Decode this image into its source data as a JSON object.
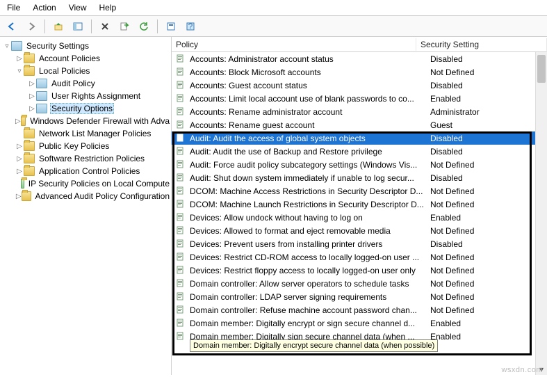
{
  "menu": {
    "file": "File",
    "action": "Action",
    "view": "View",
    "help": "Help"
  },
  "tree": {
    "root": "Security Settings",
    "items": [
      {
        "label": "Account Policies",
        "exp": "▷",
        "indent": 1,
        "sel": false
      },
      {
        "label": "Local Policies",
        "exp": "▿",
        "indent": 1,
        "sel": false
      },
      {
        "label": "Audit Policy",
        "exp": "▷",
        "indent": 2,
        "sel": false,
        "blue": true
      },
      {
        "label": "User Rights Assignment",
        "exp": "▷",
        "indent": 2,
        "sel": false,
        "blue": true
      },
      {
        "label": "Security Options",
        "exp": "▷",
        "indent": 2,
        "sel": true,
        "blue": true
      },
      {
        "label": "Windows Defender Firewall with Adva",
        "exp": "▷",
        "indent": 1,
        "sel": false
      },
      {
        "label": "Network List Manager Policies",
        "exp": "",
        "indent": 1,
        "sel": false
      },
      {
        "label": "Public Key Policies",
        "exp": "▷",
        "indent": 1,
        "sel": false
      },
      {
        "label": "Software Restriction Policies",
        "exp": "▷",
        "indent": 1,
        "sel": false
      },
      {
        "label": "Application Control Policies",
        "exp": "▷",
        "indent": 1,
        "sel": false
      },
      {
        "label": "IP Security Policies on Local Compute",
        "exp": "",
        "indent": 1,
        "sel": false,
        "ipsec": true
      },
      {
        "label": "Advanced Audit Policy Configuration",
        "exp": "▷",
        "indent": 1,
        "sel": false
      }
    ]
  },
  "list": {
    "columns": {
      "policy": "Policy",
      "setting": "Security Setting"
    },
    "rows": [
      {
        "p": "Accounts: Administrator account status",
        "s": "Disabled"
      },
      {
        "p": "Accounts: Block Microsoft accounts",
        "s": "Not Defined"
      },
      {
        "p": "Accounts: Guest account status",
        "s": "Disabled"
      },
      {
        "p": "Accounts: Limit local account use of blank passwords to co...",
        "s": "Enabled"
      },
      {
        "p": "Accounts: Rename administrator account",
        "s": "Administrator"
      },
      {
        "p": "Accounts: Rename guest account",
        "s": "Guest"
      },
      {
        "p": "Audit: Audit the access of global system objects",
        "s": "Disabled",
        "sel": true
      },
      {
        "p": "Audit: Audit the use of Backup and Restore privilege",
        "s": "Disabled"
      },
      {
        "p": "Audit: Force audit policy subcategory settings (Windows Vis...",
        "s": "Not Defined"
      },
      {
        "p": "Audit: Shut down system immediately if unable to log secur...",
        "s": "Disabled"
      },
      {
        "p": "DCOM: Machine Access Restrictions in Security Descriptor D...",
        "s": "Not Defined"
      },
      {
        "p": "DCOM: Machine Launch Restrictions in Security Descriptor D...",
        "s": "Not Defined"
      },
      {
        "p": "Devices: Allow undock without having to log on",
        "s": "Enabled"
      },
      {
        "p": "Devices: Allowed to format and eject removable media",
        "s": "Not Defined"
      },
      {
        "p": "Devices: Prevent users from installing printer drivers",
        "s": "Disabled"
      },
      {
        "p": "Devices: Restrict CD-ROM access to locally logged-on user ...",
        "s": "Not Defined"
      },
      {
        "p": "Devices: Restrict floppy access to locally logged-on user only",
        "s": "Not Defined"
      },
      {
        "p": "Domain controller: Allow server operators to schedule tasks",
        "s": "Not Defined"
      },
      {
        "p": "Domain controller: LDAP server signing requirements",
        "s": "Not Defined"
      },
      {
        "p": "Domain controller: Refuse machine account password chan...",
        "s": "Not Defined"
      },
      {
        "p": "Domain member: Digitally encrypt or sign secure channel d...",
        "s": "Enabled"
      },
      {
        "p": "Domain member: Digitally sign secure channel data (when ...",
        "s": "Enabled"
      }
    ]
  },
  "tooltip": "Domain member: Digitally encrypt secure channel data (when possible)",
  "watermark": "wsxdn.com"
}
